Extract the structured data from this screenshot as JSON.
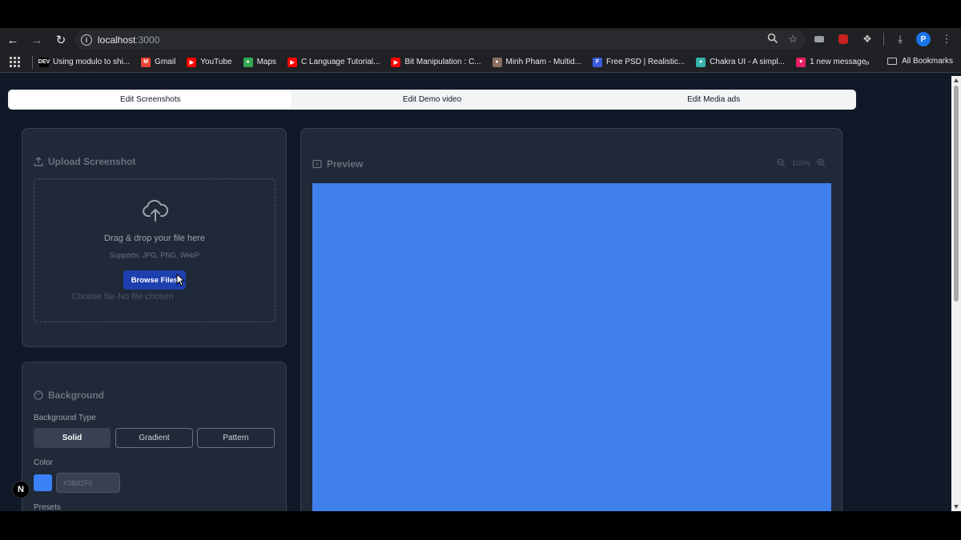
{
  "browser": {
    "url_host": "localhost",
    "url_port": ":3000",
    "profile_initial": "P",
    "bookmarks": [
      {
        "label": "Using modulo to shi...",
        "fav": "DEV",
        "color": "#000000"
      },
      {
        "label": "Gmail",
        "fav": "M",
        "color": "#ea4335"
      },
      {
        "label": "YouTube",
        "fav": "▶",
        "color": "#ff0000"
      },
      {
        "label": "Maps",
        "fav": "●",
        "color": "#34a853"
      },
      {
        "label": "C Language Tutorial...",
        "fav": "▶",
        "color": "#ff0000"
      },
      {
        "label": "Bit Manipulation : C...",
        "fav": "▶",
        "color": "#ff0000"
      },
      {
        "label": "Minh Pham - Multid...",
        "fav": "●",
        "color": "#8d6e63"
      },
      {
        "label": "Free PSD | Realistic...",
        "fav": "F",
        "color": "#3b5bdb"
      },
      {
        "label": "Chakra UI - A simpl...",
        "fav": "●",
        "color": "#38b2ac"
      },
      {
        "label": "1 new message",
        "fav": "♥",
        "color": "#e91e63"
      }
    ],
    "all_bookmarks": "All Bookmarks"
  },
  "tabs": {
    "screenshots": "Edit Screenshots",
    "demo_video": "Edit Demo video",
    "media_ads": "Edit Media ads",
    "active": "screenshots"
  },
  "upload": {
    "title": "Upload Screenshot",
    "drag_text": "Drag & drop your file here",
    "supports": "Supports: JPG, PNG, WebP",
    "browse_label": "Browse Files",
    "file_status": "Choose file No file chosen"
  },
  "background": {
    "title": "Background",
    "type_label": "Background Type",
    "types": [
      "Solid",
      "Gradient",
      "Pattern"
    ],
    "active_type": "Solid",
    "color_label": "Color",
    "color_value": "#3B82F6",
    "presets_label": "Presets"
  },
  "preview": {
    "title": "Preview",
    "zoom": "100%",
    "canvas_color": "#4080ec"
  },
  "icons": {
    "back": "arrow-left-icon",
    "forward": "arrow-right-icon",
    "reload": "reload-icon",
    "site_info": "info-icon",
    "zoom": "magnifier-icon",
    "star": "star-icon",
    "extensions": "puzzle-icon",
    "download": "download-icon",
    "menu": "kebab-menu-icon",
    "upload": "upload-icon",
    "cloud": "cloud-upload-icon",
    "palette": "palette-icon",
    "preview": "preview-icon",
    "zoom_out": "zoom-out-icon",
    "zoom_in": "zoom-in-icon"
  },
  "badge": "N"
}
